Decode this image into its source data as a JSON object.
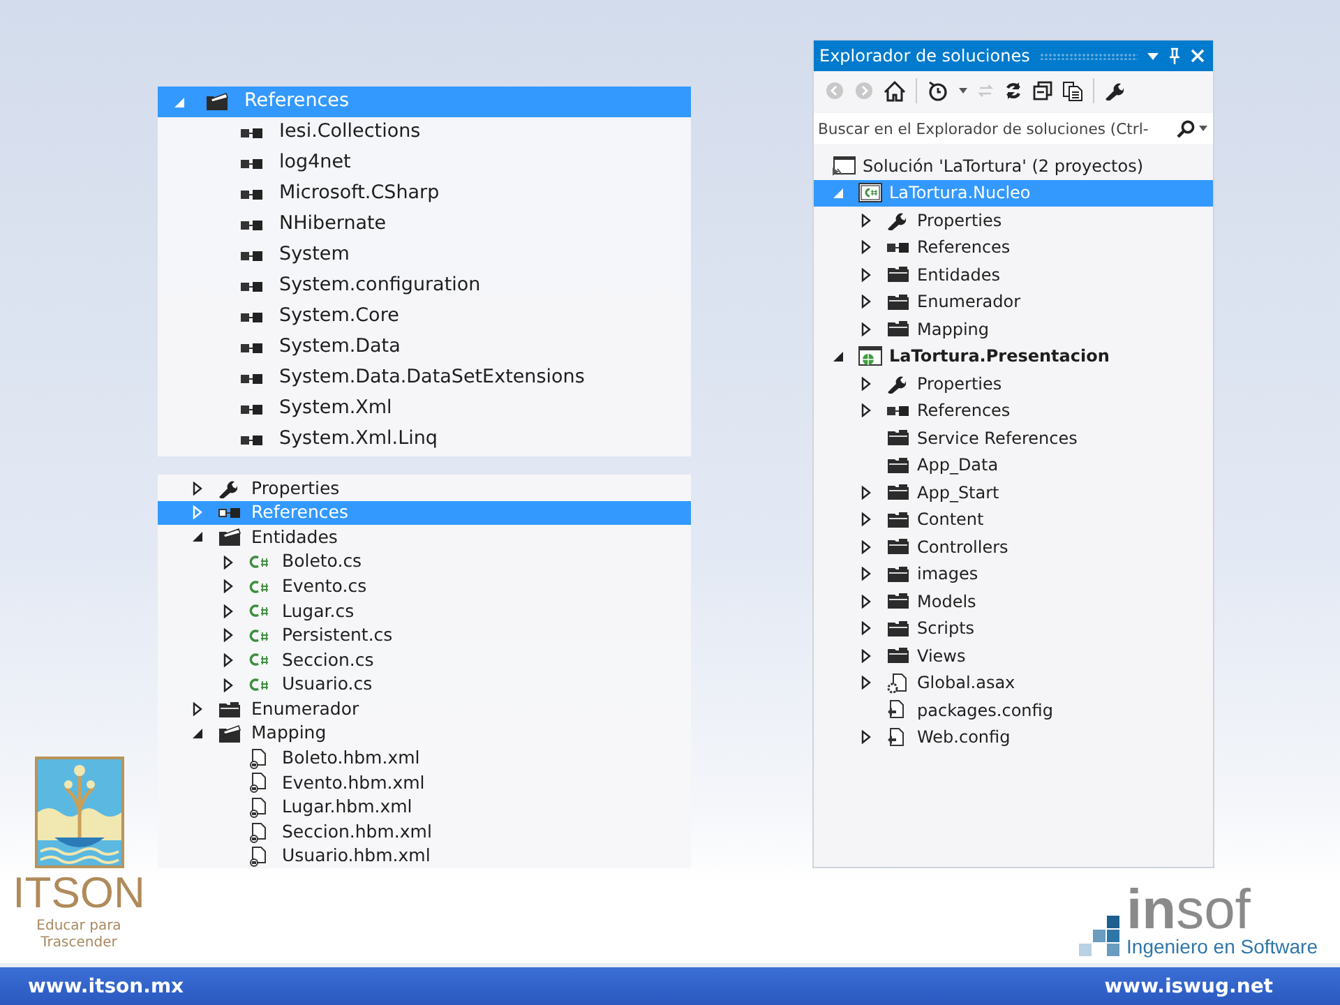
{
  "references_view": {
    "items": [
      {
        "label": "References",
        "kind": "folder-open",
        "expanded": true,
        "selected": true,
        "children": [
          {
            "label": "Iesi.Collections",
            "kind": "reference",
            "selected": false
          },
          {
            "label": "log4net",
            "kind": "reference",
            "selected": false
          },
          {
            "label": "Microsoft.CSharp",
            "kind": "reference",
            "selected": false
          },
          {
            "label": "NHibernate",
            "kind": "reference",
            "selected": false
          },
          {
            "label": "System",
            "kind": "reference",
            "selected": false
          },
          {
            "label": "System.configuration",
            "kind": "reference",
            "selected": false
          },
          {
            "label": "System.Core",
            "kind": "reference",
            "selected": false
          },
          {
            "label": "System.Data",
            "kind": "reference",
            "selected": false
          },
          {
            "label": "System.Data.DataSetExtensions",
            "kind": "reference",
            "selected": false
          },
          {
            "label": "System.Xml",
            "kind": "reference",
            "selected": false
          },
          {
            "label": "System.Xml.Linq",
            "kind": "reference",
            "selected": false
          }
        ]
      }
    ]
  },
  "project_view": {
    "items": [
      {
        "label": "Properties",
        "kind": "wrench",
        "expanded": false,
        "selected": false
      },
      {
        "label": "References",
        "kind": "reference",
        "expanded": false,
        "selected": true
      },
      {
        "label": "Entidades",
        "kind": "folder-open",
        "expanded": true,
        "selected": false,
        "children": [
          {
            "label": "Boleto.cs",
            "kind": "csharp",
            "expanded": false,
            "selected": false
          },
          {
            "label": "Evento.cs",
            "kind": "csharp",
            "expanded": false,
            "selected": false
          },
          {
            "label": "Lugar.cs",
            "kind": "csharp",
            "expanded": false,
            "selected": false
          },
          {
            "label": "Persistent.cs",
            "kind": "csharp",
            "expanded": false,
            "selected": false
          },
          {
            "label": "Seccion.cs",
            "kind": "csharp",
            "expanded": false,
            "selected": false
          },
          {
            "label": "Usuario.cs",
            "kind": "csharp",
            "expanded": false,
            "selected": false
          }
        ]
      },
      {
        "label": "Enumerador",
        "kind": "folder",
        "expanded": false,
        "selected": false
      },
      {
        "label": "Mapping",
        "kind": "folder-open",
        "expanded": true,
        "selected": false,
        "children": [
          {
            "label": "Boleto.hbm.xml",
            "kind": "xml",
            "selected": false
          },
          {
            "label": "Evento.hbm.xml",
            "kind": "xml",
            "selected": false
          },
          {
            "label": "Lugar.hbm.xml",
            "kind": "xml",
            "selected": false
          },
          {
            "label": "Seccion.hbm.xml",
            "kind": "xml",
            "selected": false
          },
          {
            "label": "Usuario.hbm.xml",
            "kind": "xml",
            "selected": false
          }
        ]
      }
    ]
  },
  "solution_explorer": {
    "title": "Explorador de soluciones",
    "search": {
      "placeholder": "Buscar en el Explorador de soluciones (Ctrl-"
    },
    "solution": {
      "label": "Solución 'LaTortura'  (2 proyectos)"
    },
    "items": [
      {
        "label": "LaTortura.Nucleo",
        "kind": "project-cs",
        "expanded": true,
        "selected": true,
        "bold": false,
        "children": [
          {
            "label": "Properties",
            "kind": "wrench",
            "expanded": false,
            "selected": false
          },
          {
            "label": "References",
            "kind": "reference",
            "expanded": false,
            "selected": false
          },
          {
            "label": "Entidades",
            "kind": "folder",
            "expanded": false,
            "selected": false
          },
          {
            "label": "Enumerador",
            "kind": "folder",
            "expanded": false,
            "selected": false
          },
          {
            "label": "Mapping",
            "kind": "folder",
            "expanded": false,
            "selected": false
          }
        ]
      },
      {
        "label": "LaTortura.Presentacion",
        "kind": "project-web",
        "expanded": true,
        "selected": false,
        "bold": true,
        "children": [
          {
            "label": "Properties",
            "kind": "wrench",
            "expanded": false,
            "selected": false
          },
          {
            "label": "References",
            "kind": "reference",
            "expanded": false,
            "selected": false
          },
          {
            "label": "Service References",
            "kind": "folder",
            "selected": false
          },
          {
            "label": "App_Data",
            "kind": "folder",
            "selected": false
          },
          {
            "label": "App_Start",
            "kind": "folder",
            "expanded": false,
            "selected": false
          },
          {
            "label": "Content",
            "kind": "folder",
            "expanded": false,
            "selected": false
          },
          {
            "label": "Controllers",
            "kind": "folder",
            "expanded": false,
            "selected": false
          },
          {
            "label": "images",
            "kind": "folder",
            "expanded": false,
            "selected": false
          },
          {
            "label": "Models",
            "kind": "folder",
            "expanded": false,
            "selected": false
          },
          {
            "label": "Scripts",
            "kind": "folder",
            "expanded": false,
            "selected": false
          },
          {
            "label": "Views",
            "kind": "folder",
            "expanded": false,
            "selected": false
          },
          {
            "label": "Global.asax",
            "kind": "global",
            "expanded": false,
            "selected": false
          },
          {
            "label": "packages.config",
            "kind": "config",
            "selected": false
          },
          {
            "label": "Web.config",
            "kind": "config",
            "expanded": false,
            "selected": false
          }
        ]
      }
    ]
  },
  "itson_logo": {
    "name": "ITSON",
    "slogan": "Educar para Trascender"
  },
  "insof_logo": {
    "name": "**in**sof",
    "tagline": "Ingeniero en Software"
  },
  "footer": {
    "left_url": "www.itson.mx",
    "right_url": "www.iswug.net"
  }
}
